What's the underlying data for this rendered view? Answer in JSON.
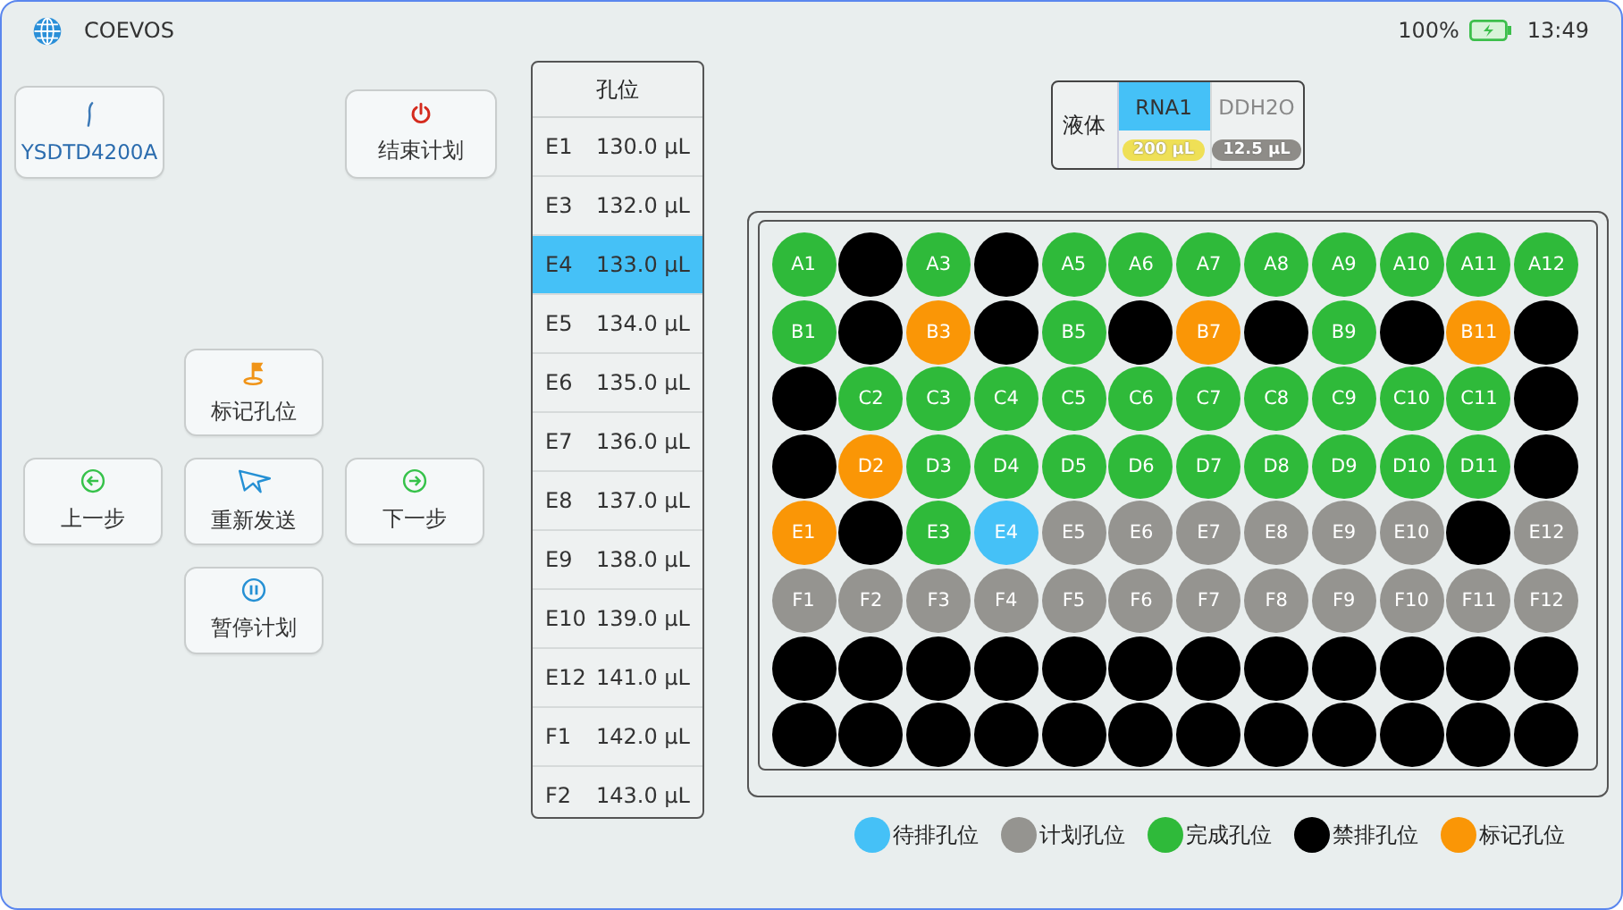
{
  "top_bar": {
    "title": "COEVOS",
    "battery_text": "100%",
    "time": "13:49"
  },
  "device_button": {
    "label": "YSDTD4200A"
  },
  "end_plan_button": {
    "label": "结束计划"
  },
  "control_pad": [
    {
      "kind": "mark",
      "label": "标记孔位"
    },
    {
      "kind": "prev",
      "label": "上一步"
    },
    {
      "kind": "resend",
      "label": "重新发送"
    },
    {
      "kind": "next",
      "label": "下一步"
    },
    {
      "kind": "pause",
      "label": "暂停计划"
    }
  ],
  "well_list": {
    "header": "孔位",
    "rows": [
      {
        "well": "E1",
        "volume": "130.0 µL",
        "selected": false
      },
      {
        "well": "E3",
        "volume": "132.0 µL",
        "selected": false
      },
      {
        "well": "E4",
        "volume": "133.0 µL",
        "selected": true
      },
      {
        "well": "E5",
        "volume": "134.0 µL",
        "selected": false
      },
      {
        "well": "E6",
        "volume": "135.0 µL",
        "selected": false
      },
      {
        "well": "E7",
        "volume": "136.0 µL",
        "selected": false
      },
      {
        "well": "E8",
        "volume": "137.0 µL",
        "selected": false
      },
      {
        "well": "E9",
        "volume": "138.0 µL",
        "selected": false
      },
      {
        "well": "E10",
        "volume": "139.0 µL",
        "selected": false
      },
      {
        "well": "E12",
        "volume": "141.0 µL",
        "selected": false
      },
      {
        "well": "F1",
        "volume": "142.0 µL",
        "selected": false
      },
      {
        "well": "F2",
        "volume": "143.0 µL",
        "selected": false
      }
    ]
  },
  "liquids": {
    "header": "液体",
    "items": [
      {
        "name": "RNA1",
        "amount": "200 µL",
        "color": "#efe056",
        "selected": true
      },
      {
        "name": "DDH2O",
        "amount": "12.5 µL",
        "color": "#8e8c88",
        "selected": false
      }
    ]
  },
  "plate": {
    "rows": [
      [
        {
          "label": "A1",
          "kind": "done"
        },
        {
          "kind": "forbidden"
        },
        {
          "label": "A3",
          "kind": "done"
        },
        {
          "kind": "forbidden"
        },
        {
          "label": "A5",
          "kind": "done"
        },
        {
          "label": "A6",
          "kind": "done"
        },
        {
          "label": "A7",
          "kind": "done"
        },
        {
          "label": "A8",
          "kind": "done"
        },
        {
          "label": "A9",
          "kind": "done"
        },
        {
          "label": "A10",
          "kind": "done"
        },
        {
          "label": "A11",
          "kind": "done"
        },
        {
          "label": "A12",
          "kind": "done"
        }
      ],
      [
        {
          "label": "B1",
          "kind": "done"
        },
        {
          "kind": "forbidden"
        },
        {
          "label": "B3",
          "kind": "marked"
        },
        {
          "kind": "forbidden"
        },
        {
          "label": "B5",
          "kind": "done"
        },
        {
          "kind": "forbidden"
        },
        {
          "label": "B7",
          "kind": "marked"
        },
        {
          "kind": "forbidden"
        },
        {
          "label": "B9",
          "kind": "done"
        },
        {
          "kind": "forbidden"
        },
        {
          "label": "B11",
          "kind": "marked"
        },
        {
          "kind": "forbidden"
        }
      ],
      [
        {
          "kind": "forbidden"
        },
        {
          "label": "C2",
          "kind": "done"
        },
        {
          "label": "C3",
          "kind": "done"
        },
        {
          "label": "C4",
          "kind": "done"
        },
        {
          "label": "C5",
          "kind": "done"
        },
        {
          "label": "C6",
          "kind": "done"
        },
        {
          "label": "C7",
          "kind": "done"
        },
        {
          "label": "C8",
          "kind": "done"
        },
        {
          "label": "C9",
          "kind": "done"
        },
        {
          "label": "C10",
          "kind": "done"
        },
        {
          "label": "C11",
          "kind": "done"
        },
        {
          "kind": "forbidden"
        }
      ],
      [
        {
          "kind": "forbidden"
        },
        {
          "label": "D2",
          "kind": "marked"
        },
        {
          "label": "D3",
          "kind": "done"
        },
        {
          "label": "D4",
          "kind": "done"
        },
        {
          "label": "D5",
          "kind": "done"
        },
        {
          "label": "D6",
          "kind": "done"
        },
        {
          "label": "D7",
          "kind": "done"
        },
        {
          "label": "D8",
          "kind": "done"
        },
        {
          "label": "D9",
          "kind": "done"
        },
        {
          "label": "D10",
          "kind": "done"
        },
        {
          "label": "D11",
          "kind": "done"
        },
        {
          "kind": "forbidden"
        }
      ],
      [
        {
          "label": "E1",
          "kind": "marked"
        },
        {
          "kind": "forbidden"
        },
        {
          "label": "E3",
          "kind": "done"
        },
        {
          "label": "E4",
          "kind": "pending"
        },
        {
          "label": "E5",
          "kind": "planned"
        },
        {
          "label": "E6",
          "kind": "planned"
        },
        {
          "label": "E7",
          "kind": "planned"
        },
        {
          "label": "E8",
          "kind": "planned"
        },
        {
          "label": "E9",
          "kind": "planned"
        },
        {
          "label": "E10",
          "kind": "planned"
        },
        {
          "kind": "forbidden"
        },
        {
          "label": "E12",
          "kind": "planned"
        }
      ],
      [
        {
          "label": "F1",
          "kind": "planned"
        },
        {
          "label": "F2",
          "kind": "planned"
        },
        {
          "label": "F3",
          "kind": "planned"
        },
        {
          "label": "F4",
          "kind": "planned"
        },
        {
          "label": "F5",
          "kind": "planned"
        },
        {
          "label": "F6",
          "kind": "planned"
        },
        {
          "label": "F7",
          "kind": "planned"
        },
        {
          "label": "F8",
          "kind": "planned"
        },
        {
          "label": "F9",
          "kind": "planned"
        },
        {
          "label": "F10",
          "kind": "planned"
        },
        {
          "label": "F11",
          "kind": "planned"
        },
        {
          "label": "F12",
          "kind": "planned"
        }
      ],
      [
        {
          "kind": "forbidden"
        },
        {
          "kind": "forbidden"
        },
        {
          "kind": "forbidden"
        },
        {
          "kind": "forbidden"
        },
        {
          "kind": "forbidden"
        },
        {
          "kind": "forbidden"
        },
        {
          "kind": "forbidden"
        },
        {
          "kind": "forbidden"
        },
        {
          "kind": "forbidden"
        },
        {
          "kind": "forbidden"
        },
        {
          "kind": "forbidden"
        },
        {
          "kind": "forbidden"
        }
      ],
      [
        {
          "kind": "forbidden"
        },
        {
          "kind": "forbidden"
        },
        {
          "kind": "forbidden"
        },
        {
          "kind": "forbidden"
        },
        {
          "kind": "forbidden"
        },
        {
          "kind": "forbidden"
        },
        {
          "kind": "forbidden"
        },
        {
          "kind": "forbidden"
        },
        {
          "kind": "forbidden"
        },
        {
          "kind": "forbidden"
        },
        {
          "kind": "forbidden"
        },
        {
          "kind": "forbidden"
        }
      ]
    ]
  },
  "legend": [
    {
      "kind": "pending",
      "label": "待排孔位",
      "color": "#45c1f7"
    },
    {
      "kind": "planned",
      "label": "计划孔位",
      "color": "#959490"
    },
    {
      "kind": "done",
      "label": "完成孔位",
      "color": "#2fba3a"
    },
    {
      "kind": "forbidden",
      "label": "禁排孔位",
      "color": "#000000"
    },
    {
      "kind": "marked",
      "label": "标记孔位",
      "color": "#fa9606"
    }
  ]
}
